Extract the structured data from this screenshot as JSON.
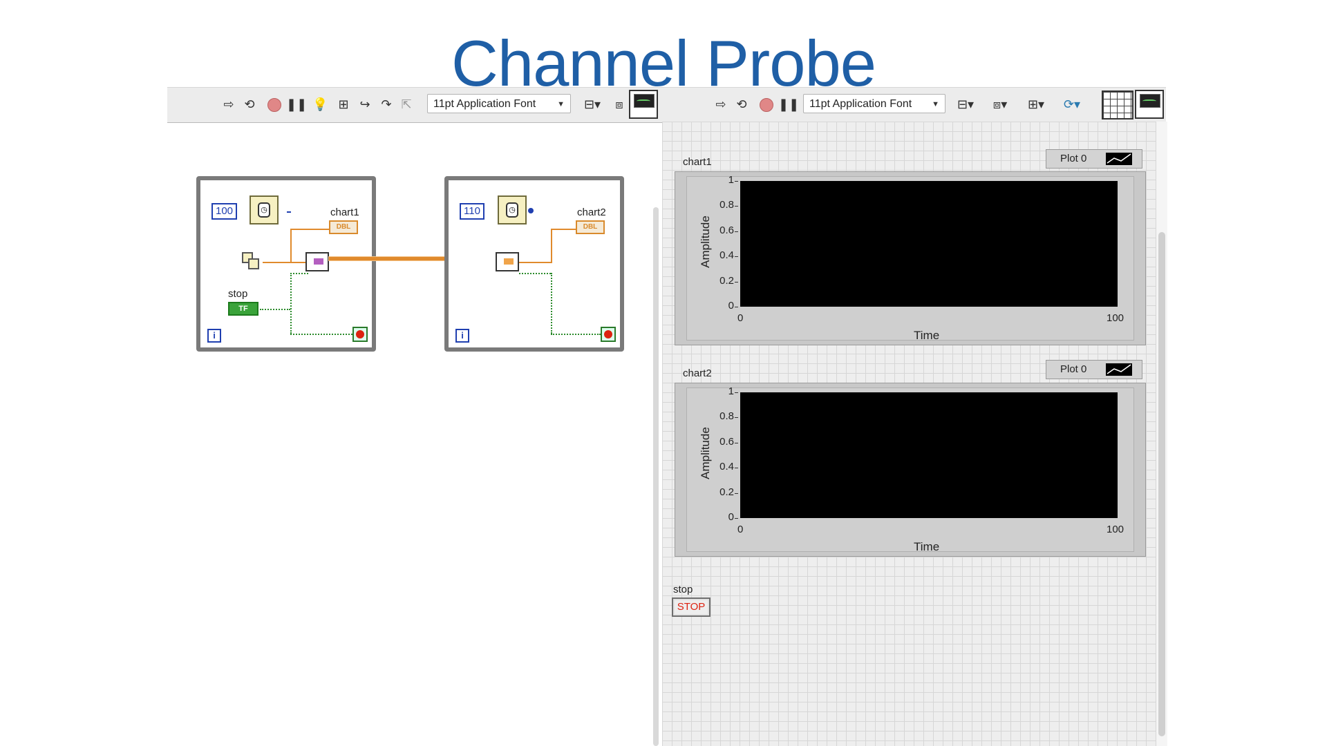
{
  "slide": {
    "title": "Channel Probe"
  },
  "block_diagram_toolbar": {
    "font": "11pt Application Font"
  },
  "front_panel_toolbar": {
    "font": "11pt Application Font"
  },
  "block_diagram": {
    "loop1": {
      "wait_ms": "100",
      "chart_label": "chart1",
      "chart_type": "DBL",
      "stop_label": "stop",
      "stop_value": "TF",
      "iter": "i"
    },
    "loop2": {
      "wait_ms": "110",
      "chart_label": "chart2",
      "chart_type": "DBL",
      "iter": "i"
    },
    "colors": {
      "wire_dbl": "#e08a2c",
      "wire_bool": "#2a8a2a",
      "numeric_const": "#1f3fb0"
    }
  },
  "front_panel": {
    "charts": [
      {
        "label": "chart1",
        "legend": "Plot 0",
        "ylabel": "Amplitude",
        "xlabel": "Time",
        "yticks": [
          "1",
          "0.8",
          "0.6",
          "0.4",
          "0.2",
          "0"
        ],
        "xticks": [
          "0",
          "100"
        ]
      },
      {
        "label": "chart2",
        "legend": "Plot 0",
        "ylabel": "Amplitude",
        "xlabel": "Time",
        "yticks": [
          "1",
          "0.8",
          "0.6",
          "0.4",
          "0.2",
          "0"
        ],
        "xticks": [
          "0",
          "100"
        ]
      }
    ],
    "stop": {
      "label": "stop",
      "button": "STOP"
    }
  }
}
